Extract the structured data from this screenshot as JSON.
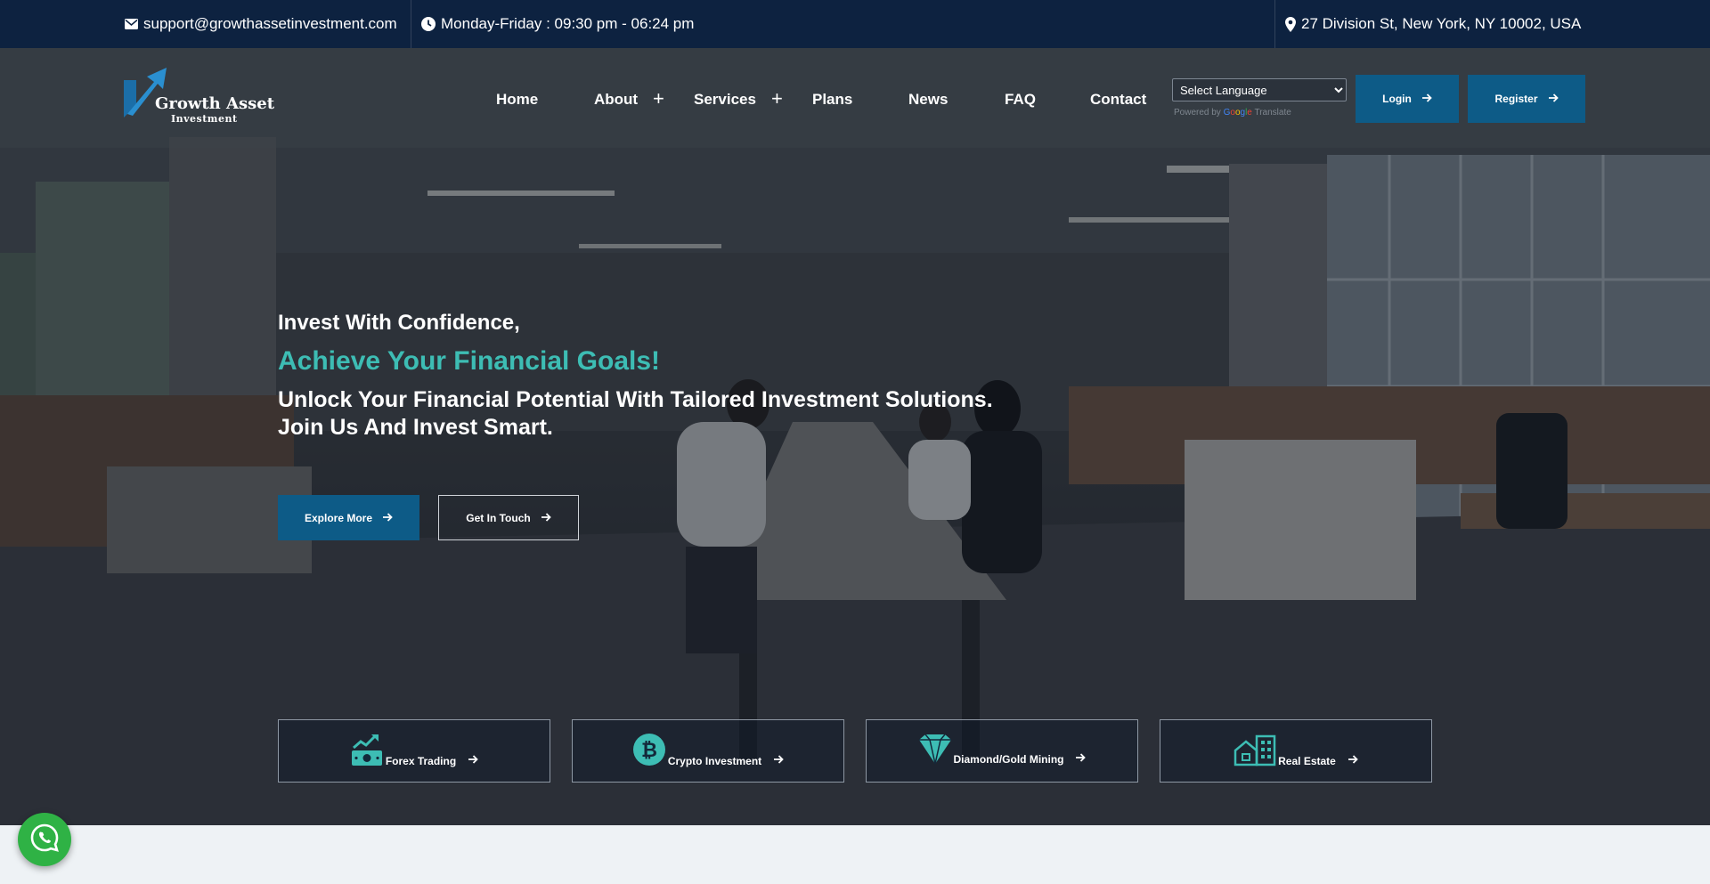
{
  "topbar": {
    "email": "support@growthassetinvestment.com",
    "hours": "Monday-Friday : 09:30 pm - 06:24 pm",
    "address": "27 Division St, New York, NY 10002, USA"
  },
  "logo": {
    "line1": "Growth Asset",
    "line2": "Investment"
  },
  "nav": {
    "home": "Home",
    "about": "About",
    "services": "Services",
    "plans": "Plans",
    "news": "News",
    "faq": "FAQ",
    "contact": "Contact",
    "expand_symbol": "+"
  },
  "language": {
    "selected": "Select Language",
    "powered_prefix": "Powered by",
    "google": [
      "G",
      "o",
      "o",
      "g",
      "l",
      "e"
    ],
    "translate": "Translate"
  },
  "auth": {
    "login": "Login",
    "register": "Register"
  },
  "hero": {
    "subtitle": "Invest With Confidence,",
    "title": "Achieve Your Financial Goals!",
    "description": "Unlock Your Financial Potential With Tailored Investment Solutions. Join Us And Invest Smart.",
    "explore": "Explore More",
    "touch": "Get In Touch"
  },
  "services": [
    {
      "label": "Forex Trading",
      "icon": "money-chart-icon"
    },
    {
      "label": "Crypto Investment",
      "icon": "bitcoin-icon"
    },
    {
      "label": "Diamond/Gold Mining",
      "icon": "diamond-icon"
    },
    {
      "label": "Real Estate",
      "icon": "building-icon"
    }
  ],
  "colors": {
    "topbar": "#0d2240",
    "primary_button": "#0d5b87",
    "accent_teal": "#3dbdb4",
    "whatsapp": "#2fb245"
  }
}
